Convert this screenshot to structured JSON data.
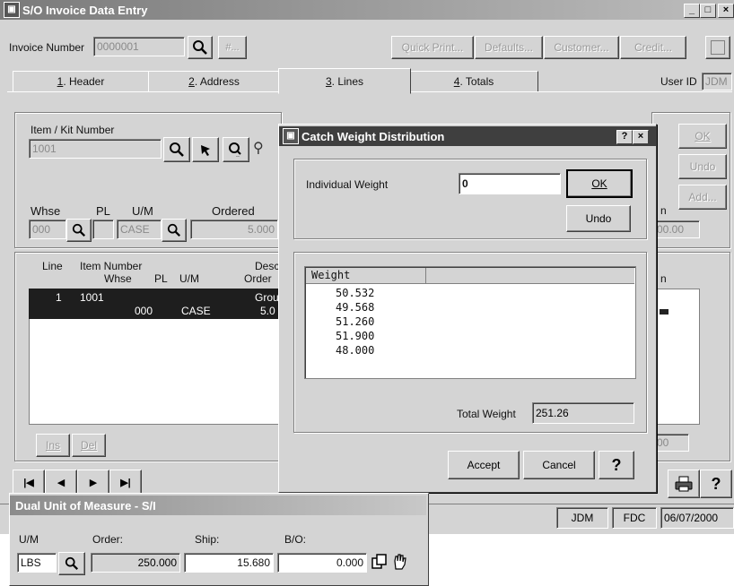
{
  "main": {
    "title": "S/O Invoice Data Entry",
    "invoice_label": "Invoice Number",
    "invoice_value": "0000001",
    "hash_label": "#...",
    "toolbar": {
      "quick_print": "Quick Print...",
      "defaults": "Defaults...",
      "customer": "Customer...",
      "credit": "Credit..."
    },
    "tabs": [
      {
        "num": "1",
        "label": ". Header"
      },
      {
        "num": "2",
        "label": ". Address"
      },
      {
        "num": "3",
        "label": ". Lines"
      },
      {
        "num": "4",
        "label": ". Totals"
      }
    ],
    "user_id_label": "User ID",
    "user_id_value": "JDM",
    "item_label": "Item / Kit Number",
    "item_value": "1001",
    "whse_label": "Whse",
    "pl_label": "PL",
    "um_label": "U/M",
    "ordered_label": "Ordered",
    "whse_value": "000",
    "um_value": "CASE",
    "ordered_value": "5.000",
    "right_ok": "OK",
    "right_undo": "Undo",
    "right_add": "Add...",
    "right_partial": "n",
    "right_value": "00.00",
    "grid_headers": {
      "line": "Line",
      "item_number": "Item Number",
      "whse": "Whse",
      "pl": "PL",
      "um": "U/M",
      "desc": "Desc",
      "order": "Order"
    },
    "grid_right_header": "n",
    "grid_row": {
      "line": "1",
      "item": "1001",
      "whse": "000",
      "um": "CASE",
      "desc": "Grour",
      "order": "5.0"
    },
    "ins_label": "Ins",
    "del_label": "Del",
    "bottom_value": "00",
    "nav": [
      "|◀",
      "◀",
      "▶",
      "▶|"
    ],
    "status": {
      "user": "JDM",
      "company": "FDC",
      "date": "06/07/2000"
    }
  },
  "catch_weight": {
    "title": "Catch Weight Distribution",
    "individual_weight_label": "Individual Weight",
    "individual_weight_value": "0",
    "ok_label": "OK",
    "undo_label": "Undo",
    "list_header": "Weight",
    "weights": [
      "50.532",
      "49.568",
      "51.260",
      "51.900",
      "48.000"
    ],
    "total_label": "Total Weight",
    "total_value": "251.26",
    "accept_label": "Accept",
    "cancel_label": "Cancel",
    "help_label": "?"
  },
  "dual_uom": {
    "title": "Dual Unit of Measure - S/I",
    "um_label": "U/M",
    "order_label": "Order:",
    "ship_label": "Ship:",
    "bo_label": "B/O:",
    "um_value": "LBS",
    "order_value": "250.000",
    "ship_value": "15.680",
    "bo_value": "0.000"
  }
}
